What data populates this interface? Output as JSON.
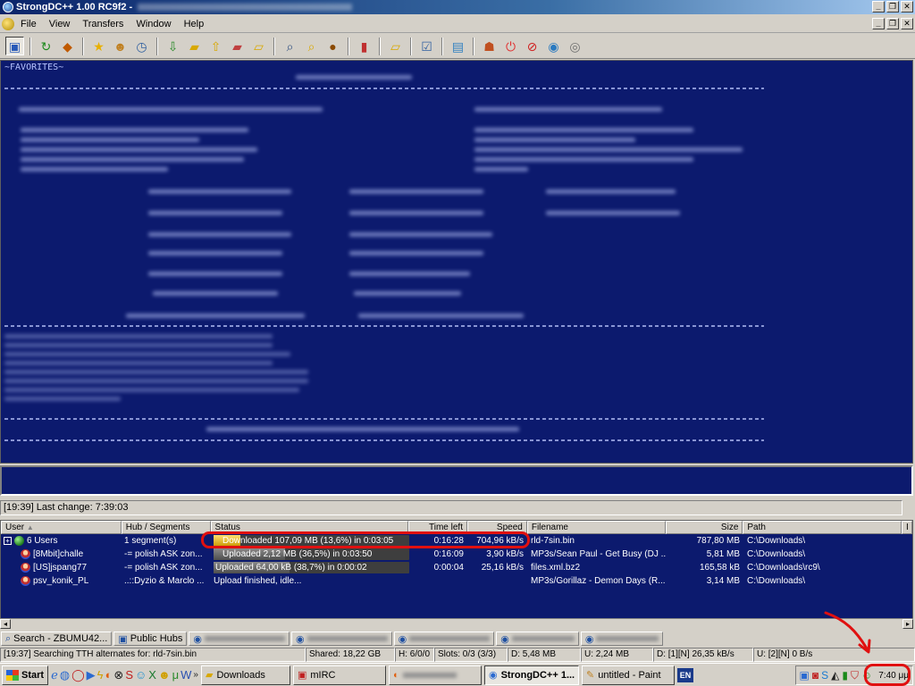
{
  "window": {
    "title": "StrongDC++ 1.00 RC9f2 -",
    "btn_minimize": "_",
    "btn_restore": "❐",
    "btn_close": "✕"
  },
  "menu": [
    "File",
    "View",
    "Transfers",
    "Window",
    "Help"
  ],
  "toolbar_icons": [
    "public-hubs-icon",
    "reconnect-icon",
    "follow-redirect-icon",
    "favorite-hubs-icon",
    "favorite-users-icon",
    "recent-hubs-icon",
    "queue-icon",
    "finished-icon",
    "upload-queue-icon",
    "finished-uploads-icon",
    "search-icon",
    "adl-search-icon",
    "search-spy-icon",
    "network-stats-icon",
    "open-filelist-icon",
    "settings-icon",
    "notepad-icon",
    "upload-icon",
    "disconnect-icon",
    "limiter-icon",
    "globe-icon",
    "sound-icon"
  ],
  "hub_chat": {
    "heading": "~FAVORITES~",
    "background": "#0c1a6e"
  },
  "hub_status": "[19:39] Last change: 7:39:03",
  "transfers": {
    "columns": {
      "user": "User",
      "hub": "Hub / Segments",
      "status": "Status",
      "time_left": "Time left",
      "speed": "Speed",
      "filename": "Filename",
      "size": "Size",
      "path": "Path",
      "extra": "I"
    },
    "rows": [
      {
        "user": "6 Users",
        "hub": "1 segment(s)",
        "status": "Downloaded 107,09 MB (13,6%) in 0:03:05",
        "progress": 13.6,
        "kind": "download",
        "time_left": "0:16:28",
        "speed": "704,96 kB/s",
        "filename": "rld-7sin.bin",
        "size": "787,80 MB",
        "path": "C:\\Downloads\\"
      },
      {
        "user": "[8Mbit]challe",
        "hub": "-= polish ASK zon...",
        "status": "Uploaded 2,12 MB (36,5%) in 0:03:50",
        "progress": 36.5,
        "kind": "upload",
        "time_left": "0:16:09",
        "speed": "3,90 kB/s",
        "filename": "MP3s/Sean Paul - Get Busy (DJ ...",
        "size": "5,81 MB",
        "path": "C:\\Downloads\\"
      },
      {
        "user": "[US]jspang77",
        "hub": "-= polish ASK zon...",
        "status": "Uploaded 64,00 kB (38,7%) in 0:00:02",
        "progress": 38.7,
        "kind": "upload",
        "time_left": "0:00:04",
        "speed": "25,16 kB/s",
        "filename": "files.xml.bz2",
        "size": "165,58 kB",
        "path": "C:\\Downloads\\rc9\\"
      },
      {
        "user": "psv_konik_PL",
        "hub": "..::Dyzio & Marclo ...",
        "status": "Upload finished, idle...",
        "progress": 0,
        "kind": "idle",
        "time_left": "",
        "speed": "",
        "filename": "MP3s/Gorillaz - Demon Days (R...",
        "size": "3,14 MB",
        "path": "C:\\Downloads\\"
      }
    ]
  },
  "window_tabs": [
    {
      "label": "Search - ZBUMU42...",
      "icon": "search-icon"
    },
    {
      "label": "Public Hubs",
      "icon": "public-hubs-icon"
    }
  ],
  "app_status": {
    "message": "[19:37] Searching TTH alternates for: rld-7sin.bin",
    "shared": "Shared: 18,22 GB",
    "hubs": "H: 6/0/0",
    "slots": "Slots: 0/3 (3/3)",
    "down_total": "D: 5,48 MB",
    "up_total": "U: 2,24 MB",
    "down_rate": "D: [1][N] 26,35 kB/s",
    "up_rate": "U: [2][N] 0 B/s"
  },
  "taskbar": {
    "start": "Start",
    "tasks": [
      {
        "label": "Downloads",
        "icon": "folder-icon",
        "active": false
      },
      {
        "label": "mIRC",
        "icon": "mirc-icon",
        "active": false
      },
      {
        "label": "",
        "icon": "firefox-icon",
        "active": false
      },
      {
        "label": "StrongDC++ 1...",
        "icon": "strongdc-icon",
        "active": true
      },
      {
        "label": "untitled - Paint",
        "icon": "paint-icon",
        "active": false
      }
    ],
    "language": "EN",
    "clock": "7:40 μμ"
  },
  "colors": {
    "dark_blue": "#0c1a6e",
    "highlight_red": "#e01010",
    "download_bar": "#e8b800"
  }
}
